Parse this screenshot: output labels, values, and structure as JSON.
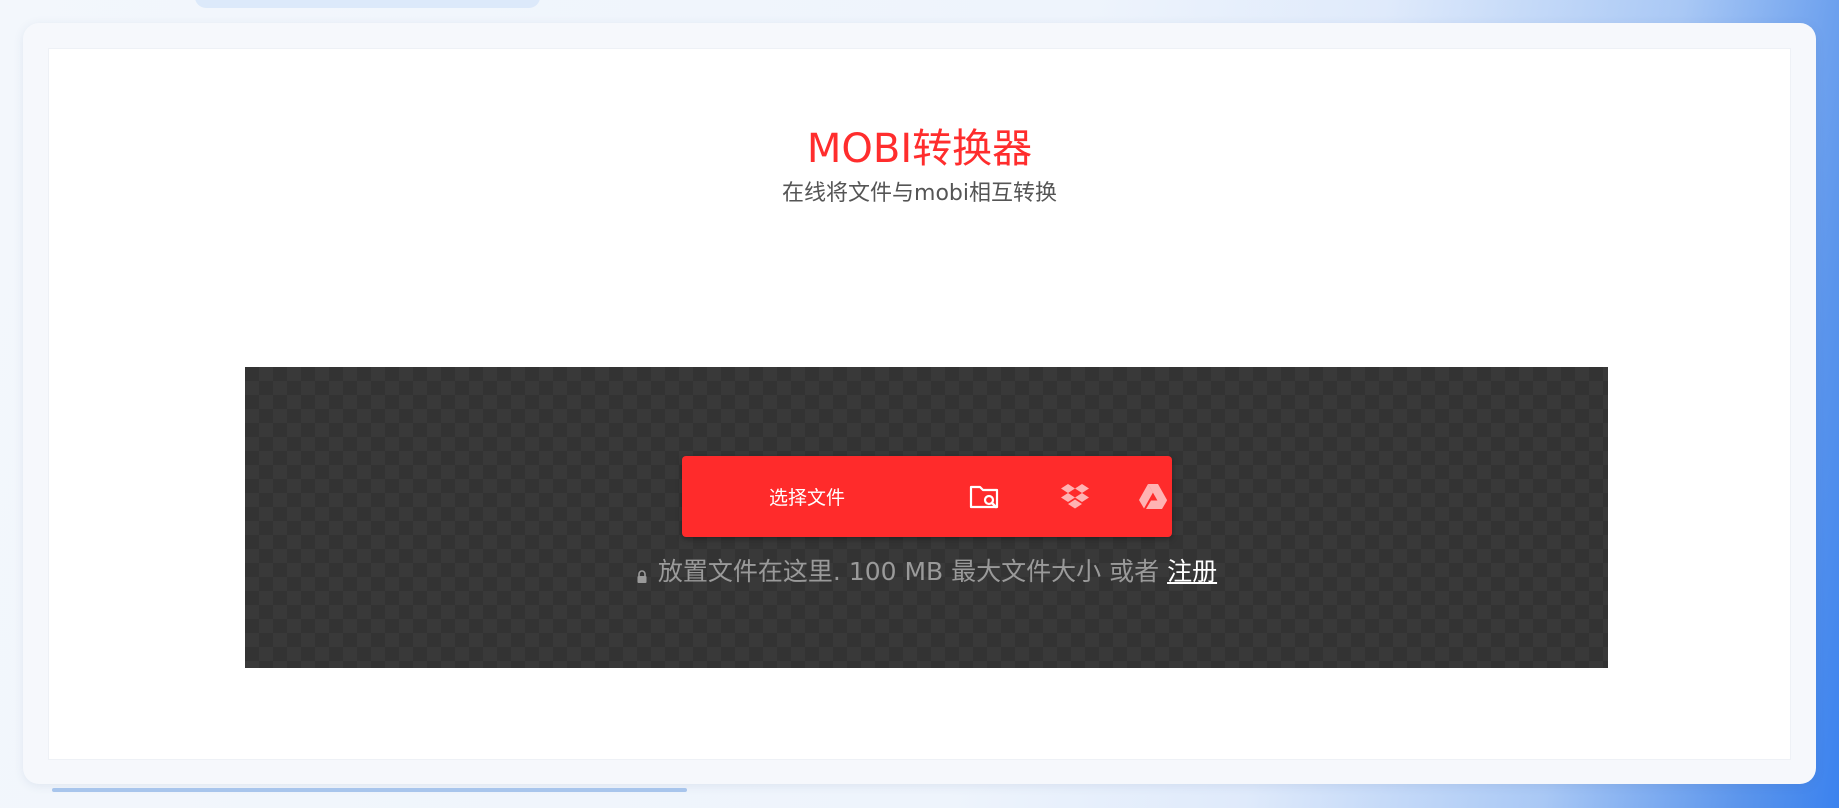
{
  "header": {
    "title": "MOBI转换器",
    "subtitle": "在线将文件与mobi相互转换"
  },
  "uploader": {
    "choose_label": "选择文件",
    "sources": [
      {
        "name": "folder-search-icon"
      },
      {
        "name": "dropbox-icon"
      },
      {
        "name": "google-drive-icon"
      }
    ],
    "hint_text": "放置文件在这里. 100 MB 最大文件大小 或者",
    "signup_label": "注册"
  },
  "colors": {
    "accent": "#ff2d2d",
    "dropzone_bg": "#333333",
    "hint_text": "#9a9a9a"
  }
}
